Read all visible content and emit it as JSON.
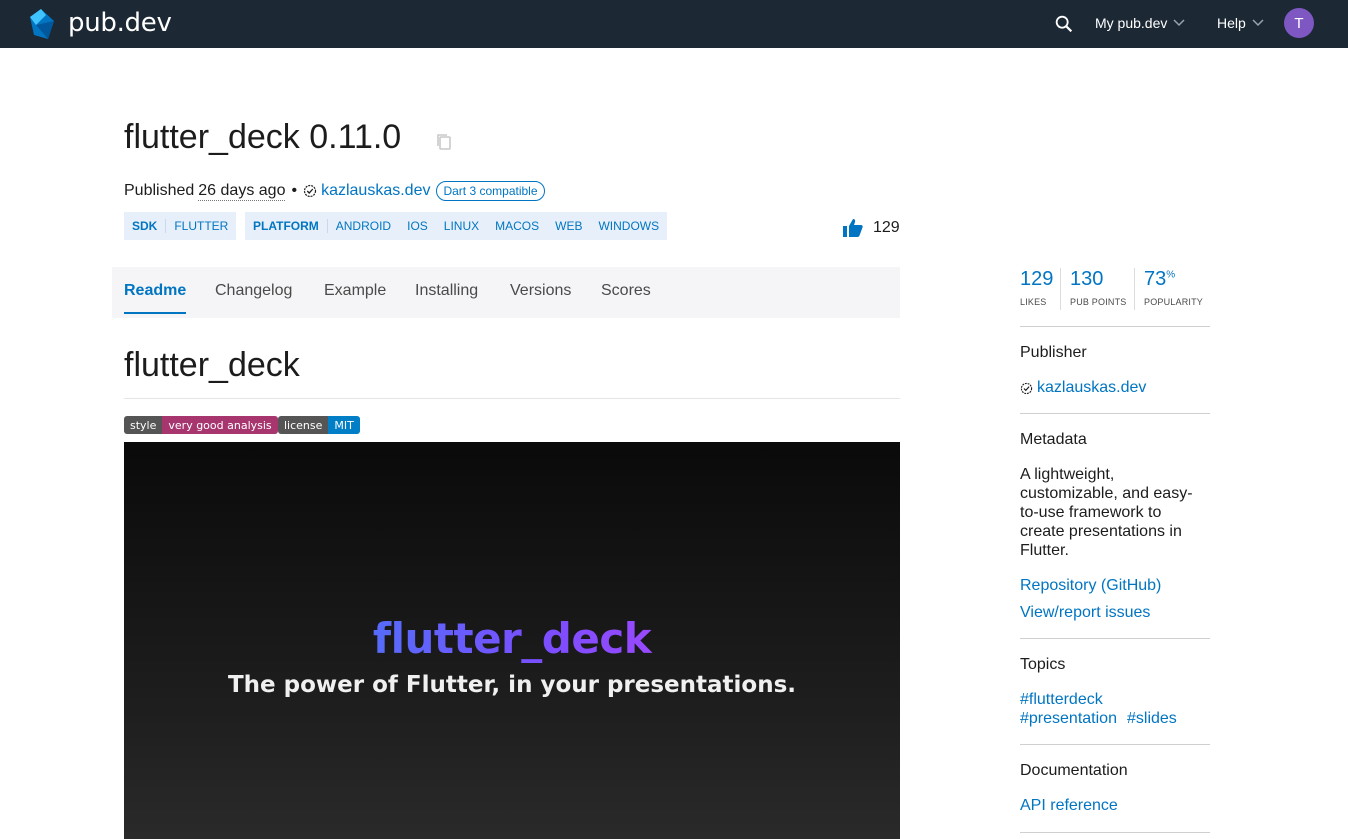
{
  "topbar": {
    "site_name": "pub.dev",
    "nav_my": "My pub.dev",
    "nav_help": "Help",
    "avatar_letter": "T"
  },
  "package": {
    "title": "flutter_deck 0.11.0",
    "published_label": "Published",
    "published_ago": "26 days ago",
    "separator": "•",
    "publisher": "kazlauskas.dev",
    "dart3_badge": "Dart 3 compatible",
    "likes": "129"
  },
  "tags": {
    "sdk_head": "SDK",
    "sdk": [
      "FLUTTER"
    ],
    "platform_head": "PLATFORM",
    "platforms": [
      "ANDROID",
      "IOS",
      "LINUX",
      "MACOS",
      "WEB",
      "WINDOWS"
    ]
  },
  "tabs": [
    "Readme",
    "Changelog",
    "Example",
    "Installing",
    "Versions",
    "Scores"
  ],
  "readme": {
    "heading": "flutter_deck",
    "badge1_left": "style",
    "badge1_right": "very good analysis",
    "badge2_left": "license",
    "badge2_right": "MIT",
    "hero_title": "flutter_deck",
    "hero_subtitle": "The power of Flutter, in your presentations."
  },
  "sidebar": {
    "scores": {
      "likes_value": "129",
      "likes_label": "LIKES",
      "points_value": "130",
      "points_label": "PUB POINTS",
      "popularity_value": "73",
      "popularity_unit": "%",
      "popularity_label": "POPULARITY"
    },
    "publisher_heading": "Publisher",
    "publisher_link": "kazlauskas.dev",
    "metadata_heading": "Metadata",
    "description": "A lightweight, customizable, and easy-to-use framework to create presentations in Flutter.",
    "repo_link": "Repository (GitHub)",
    "issues_link": "View/report issues",
    "topics_heading": "Topics",
    "topics": [
      "#flutterdeck",
      "#presentation",
      "#slides"
    ],
    "documentation_heading": "Documentation",
    "api_link": "API reference"
  },
  "colors": {
    "topbar": "#1c2834",
    "link": "#0175c2",
    "badge_magenta": "#a7366f",
    "badge_blue": "#007ec6",
    "avatar": "#7e57c2"
  }
}
